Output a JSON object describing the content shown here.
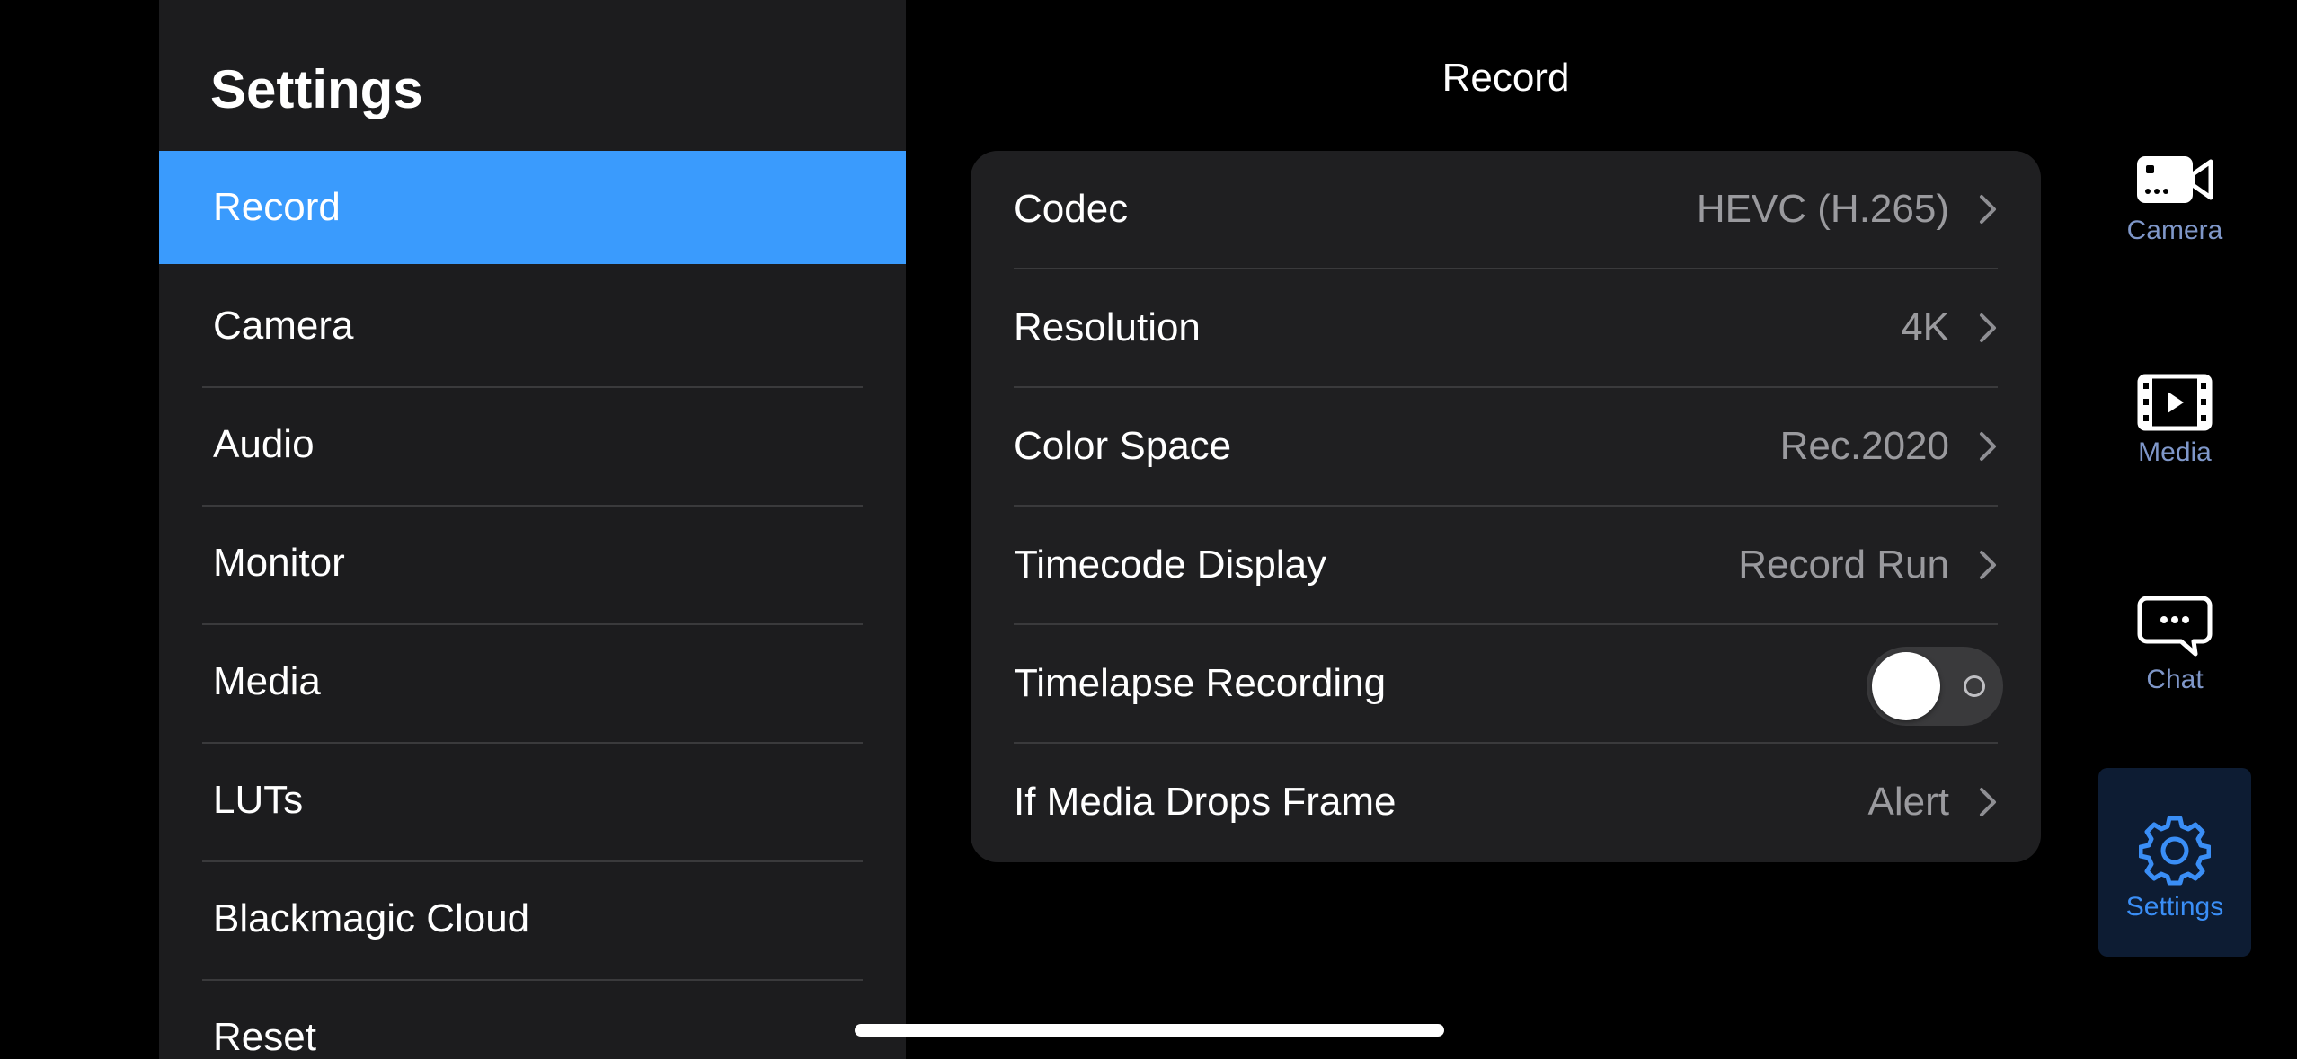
{
  "sidebar": {
    "title": "Settings",
    "items": [
      {
        "label": "Record",
        "active": true
      },
      {
        "label": "Camera"
      },
      {
        "label": "Audio"
      },
      {
        "label": "Monitor"
      },
      {
        "label": "Media"
      },
      {
        "label": "LUTs"
      },
      {
        "label": "Blackmagic Cloud"
      },
      {
        "label": "Reset"
      }
    ]
  },
  "panel": {
    "title": "Record",
    "rows": [
      {
        "label": "Codec",
        "value": "HEVC (H.265)",
        "icon": "chevron-right-icon"
      },
      {
        "label": "Resolution",
        "value": "4K",
        "icon": "chevron-right-icon"
      },
      {
        "label": "Color Space",
        "value": "Rec.2020",
        "icon": "chevron-right-icon"
      },
      {
        "label": "Timecode Display",
        "value": "Record Run",
        "icon": "chevron-right-icon"
      },
      {
        "label": "Timelapse Recording",
        "toggle": false
      },
      {
        "label": "If Media Drops Frame",
        "value": "Alert",
        "icon": "chevron-right-icon"
      }
    ]
  },
  "tabs": [
    {
      "label": "Camera",
      "icon": "video-camera-icon"
    },
    {
      "label": "Media",
      "icon": "film-play-icon"
    },
    {
      "label": "Chat",
      "icon": "chat-bubble-icon"
    },
    {
      "label": "Settings",
      "icon": "gear-icon",
      "active": true
    }
  ],
  "colors": {
    "accent": "#3a9bfd",
    "tab_inactive": "#7f97c9",
    "tab_active": "#3a8ef6",
    "sidebar_bg": "#1c1c1e",
    "card_bg": "#1f1f21",
    "value_text": "#9a9a9e"
  }
}
